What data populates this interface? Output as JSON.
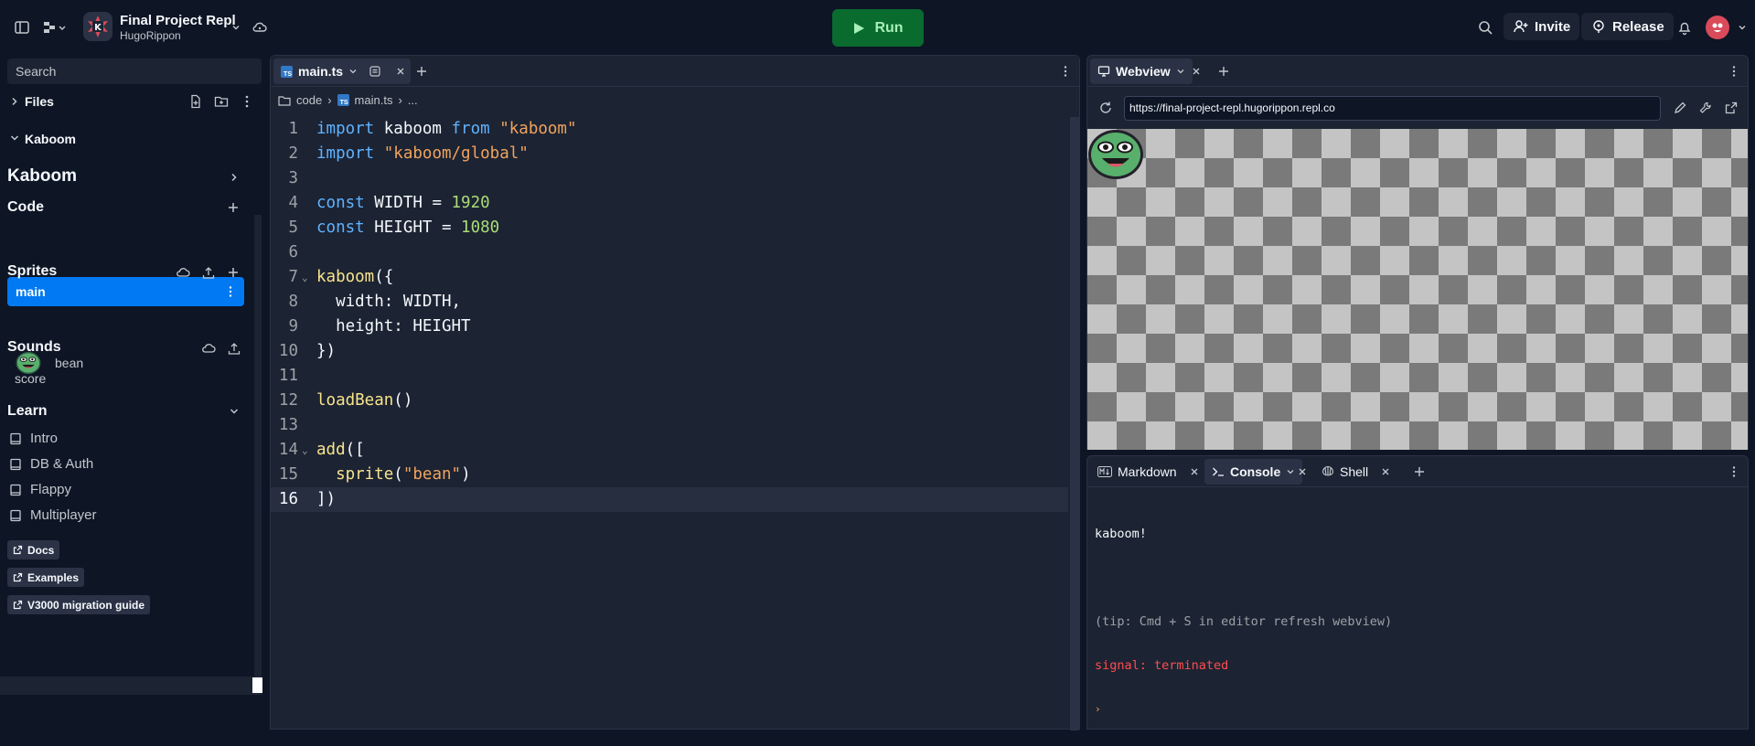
{
  "topbar": {
    "project_name": "Final Project Repl",
    "owner": "HugoRippon",
    "run_label": "Run",
    "invite_label": "Invite",
    "release_label": "Release"
  },
  "sidebar": {
    "search_placeholder": "Search",
    "files_label": "Files",
    "kaboom_section_label": "Kaboom",
    "kaboom_title": "Kaboom",
    "code_label": "Code",
    "main_item": "main",
    "sprites_label": "Sprites",
    "sprite_name": "bean",
    "sounds_label": "Sounds",
    "sound_name": "score",
    "learn_label": "Learn",
    "learn_items": [
      "Intro",
      "DB & Auth",
      "Flappy",
      "Multiplayer"
    ],
    "links": [
      "Docs",
      "Examples",
      "V3000 migration guide"
    ]
  },
  "editor": {
    "tab_label": "main.ts",
    "breadcrumb": [
      "code",
      "main.ts",
      "..."
    ],
    "line_numbers": [
      "1",
      "2",
      "3",
      "4",
      "5",
      "6",
      "7",
      "8",
      "9",
      "10",
      "11",
      "12",
      "13",
      "14",
      "15",
      "16"
    ],
    "active_line": 16
  },
  "webview": {
    "tab_label": "Webview",
    "url": "https://final-project-repl.hugorippon.repl.co"
  },
  "console": {
    "tabs": [
      "Markdown",
      "Console",
      "Shell"
    ],
    "output_line1": "kaboom!",
    "output_tip": "(tip: Cmd + S in editor refresh webview)",
    "output_error": "signal: terminated",
    "prompt": "›"
  },
  "colors": {
    "background": "#0e1525",
    "surface": "#1c2333",
    "accent_blue": "#0079f2",
    "run_green": "#0a6b2e",
    "error_red": "#ff4d4d"
  }
}
